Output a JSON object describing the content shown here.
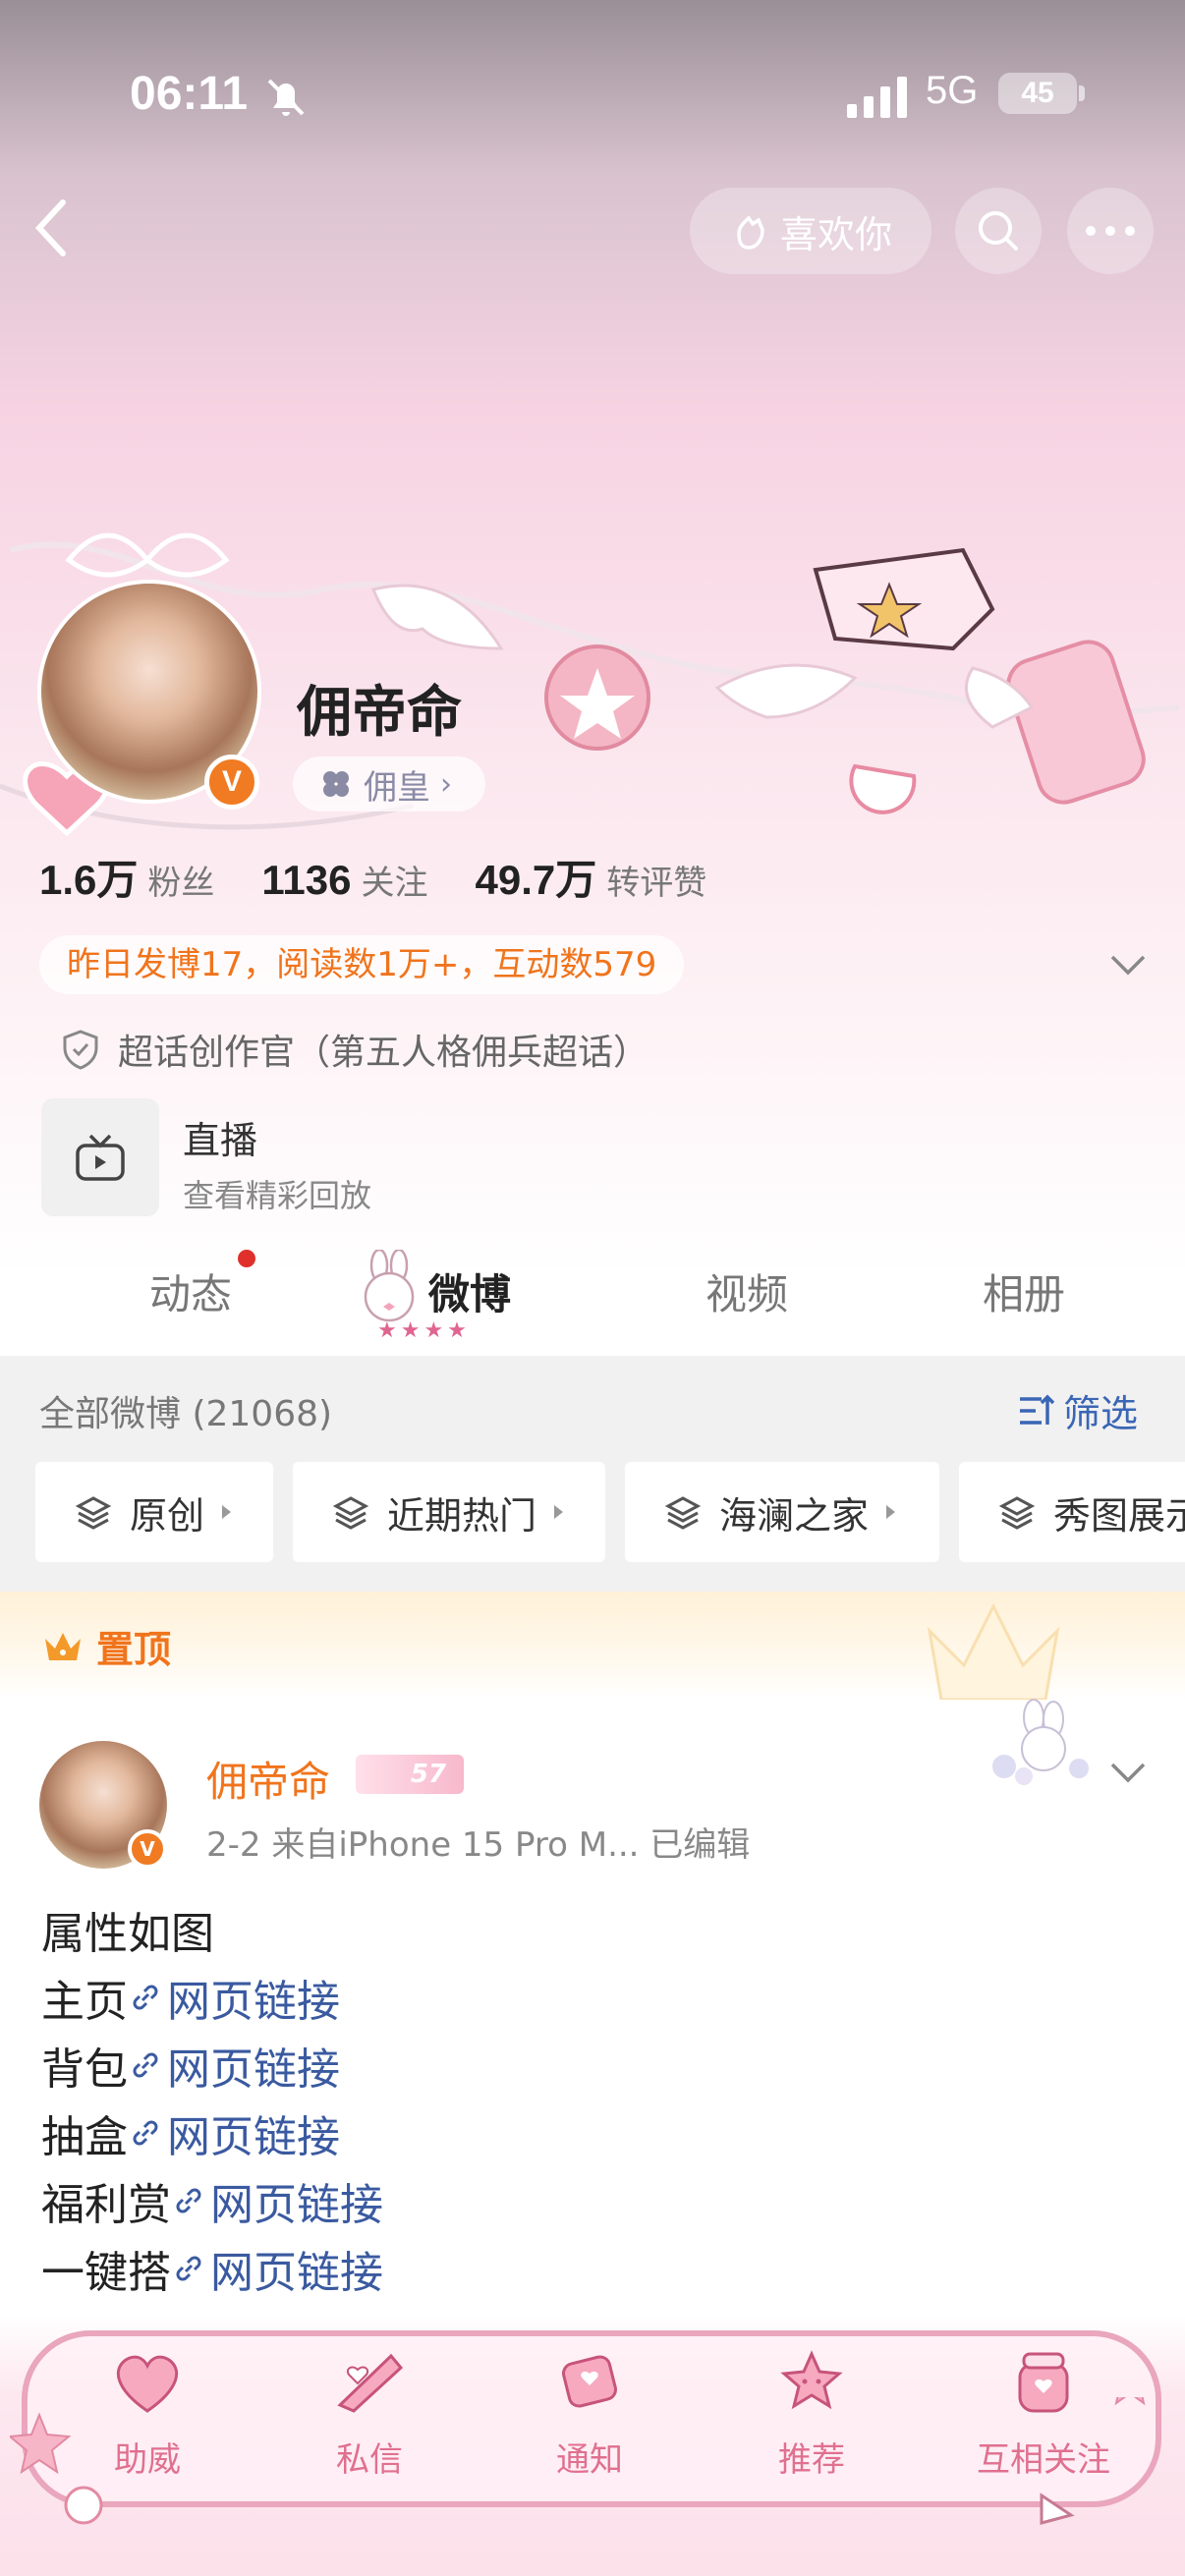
{
  "status_bar": {
    "time": "06:11",
    "network": "5G",
    "battery": "45"
  },
  "header": {
    "like_button_label": "喜欢你"
  },
  "profile": {
    "username": "佣帝命",
    "rank_label": "佣皇",
    "stats": [
      {
        "value": "1.6万",
        "label": "粉丝"
      },
      {
        "value": "1136",
        "label": "关注"
      },
      {
        "value": "49.7万",
        "label": "转评赞"
      }
    ],
    "notice": "昨日发博17，阅读数1万+，互动数579",
    "super_topic": "超话创作官（第五人格佣兵超话）",
    "live": {
      "title": "直播",
      "subtitle": "查看精彩回放"
    }
  },
  "tabs": [
    {
      "label": "动态"
    },
    {
      "label": "微博",
      "active": true
    },
    {
      "label": "视频"
    },
    {
      "label": "相册"
    }
  ],
  "feed": {
    "all_label": "全部微博 (21068)",
    "filter_label": "筛选",
    "chips": [
      "原创",
      "近期热门",
      "海澜之家",
      "秀图展示"
    ]
  },
  "pinned": {
    "label": "置顶",
    "author": "佣帝命",
    "level": "57",
    "meta": "2-2  来自iPhone 15 Pro M...  已编辑",
    "lines": [
      {
        "text": "属性如图"
      },
      {
        "text": "主页 ",
        "link": "网页链接"
      },
      {
        "text": "背包 ",
        "link": "网页链接"
      },
      {
        "text": "抽盒",
        "link": "网页链接"
      },
      {
        "text": "福利赏 ",
        "link": "网页链接"
      },
      {
        "text": "一键搭",
        "link": "网页链接"
      }
    ]
  },
  "bottom_bar": {
    "items": [
      {
        "label": "助威",
        "icon": "cheer-icon"
      },
      {
        "label": "私信",
        "icon": "message-icon"
      },
      {
        "label": "通知",
        "icon": "notification-icon"
      },
      {
        "label": "推荐",
        "icon": "recommend-icon"
      },
      {
        "label": "互相关注",
        "icon": "mutual-follow-icon"
      }
    ]
  },
  "colors": {
    "accent_orange": "#f0741c",
    "link_blue": "#3a5aa0",
    "pink": "#e0708f"
  }
}
